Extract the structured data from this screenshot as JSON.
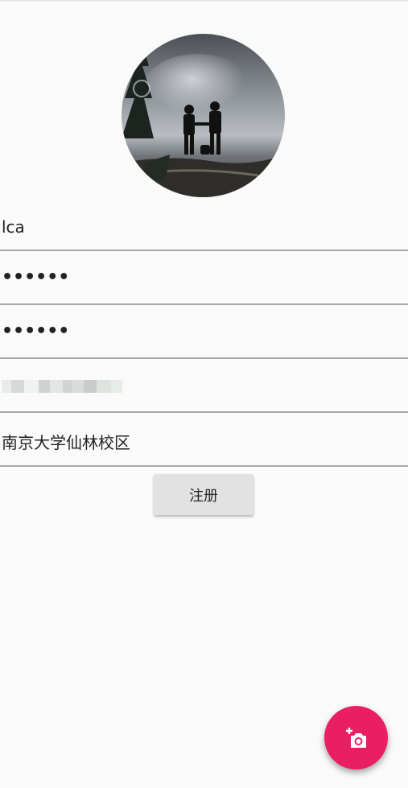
{
  "avatar": {
    "description": "profile-photo"
  },
  "form": {
    "username_value": "lca",
    "password_value": "••••••",
    "confirm_password_value": "••••••",
    "phone_value_redacted": true,
    "address_value": "南京大学仙林校区"
  },
  "register_button": {
    "label": "注册"
  },
  "fab": {
    "icon": "add-photo-icon"
  },
  "colors": {
    "background": "#fafafa",
    "underline": "#a8a8a8",
    "button": "#e2e2e2",
    "fab": "#e91e63"
  }
}
